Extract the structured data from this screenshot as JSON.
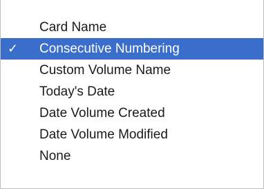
{
  "menu": {
    "items": [
      {
        "label": "Card Name",
        "check": "",
        "selected": false
      },
      {
        "label": "Consecutive Numbering",
        "check": "✓",
        "selected": true
      },
      {
        "label": "Custom Volume Name",
        "check": "",
        "selected": false
      },
      {
        "label": "Today's Date",
        "check": "",
        "selected": false
      },
      {
        "label": "Date Volume Created",
        "check": "",
        "selected": false
      },
      {
        "label": "Date Volume Modified",
        "check": "",
        "selected": false
      },
      {
        "label": "None",
        "check": "",
        "selected": false
      }
    ]
  },
  "colors": {
    "highlight": "#3b6ecb",
    "highlight_text": "#ffffff",
    "text": "#1a1a1a",
    "background": "#ffffff"
  }
}
